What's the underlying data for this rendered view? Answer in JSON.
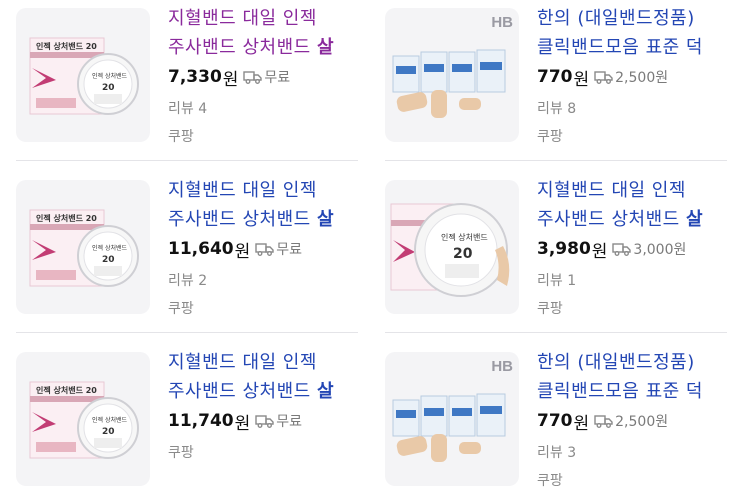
{
  "products": [
    {
      "title_a": "지혈밴드 대일 인젝 주사밴드 상처밴드 ",
      "title_b": "살",
      "price": "7,330",
      "won": "원",
      "shipping": "무료",
      "reviews": "리뷰 4",
      "seller": "쿠팡",
      "visited": true,
      "thumb": "injection-band"
    },
    {
      "title_a": "한의 (대일밴드정품)클릭밴드모음 표준 덕",
      "title_b": "",
      "price": "770",
      "won": "원",
      "shipping": "2,500원",
      "reviews": "리뷰 8",
      "seller": "쿠팡",
      "visited": false,
      "thumb": "hb-boxes"
    },
    {
      "title_a": "지혈밴드 대일 인젝 주사밴드 상처밴드 ",
      "title_b": "살",
      "price": "11,640",
      "won": "원",
      "shipping": "무료",
      "reviews": "리뷰 2",
      "seller": "쿠팡",
      "visited": false,
      "thumb": "injection-band"
    },
    {
      "title_a": "지혈밴드 대일 인젝 주사밴드 상처밴드 ",
      "title_b": "살",
      "price": "3,980",
      "won": "원",
      "shipping": "3,000원",
      "reviews": "리뷰 1",
      "seller": "쿠팡",
      "visited": false,
      "thumb": "injection-band-large"
    },
    {
      "title_a": "지혈밴드 대일 인젝 주사밴드 상처밴드 ",
      "title_b": "살",
      "price": "11,740",
      "won": "원",
      "shipping": "무료",
      "reviews": "",
      "seller": "쿠팡",
      "visited": false,
      "thumb": "injection-band"
    },
    {
      "title_a": "한의 (대일밴드정품)클릭밴드모음 표준 덕",
      "title_b": "",
      "price": "770",
      "won": "원",
      "shipping": "2,500원",
      "reviews": "리뷰 3",
      "seller": "쿠팡",
      "visited": false,
      "thumb": "hb-boxes"
    }
  ],
  "thumb_text": {
    "box_brand": "인젝 상처밴드 20",
    "roll_label": "인젝 상처밴드",
    "roll_number": "20",
    "hb_logo": "HB"
  },
  "colors": {
    "title": "#2346b4",
    "title_visited": "#8a2a9c",
    "box_pink": "#d9a7b6",
    "box_magenta": "#c23d74"
  }
}
